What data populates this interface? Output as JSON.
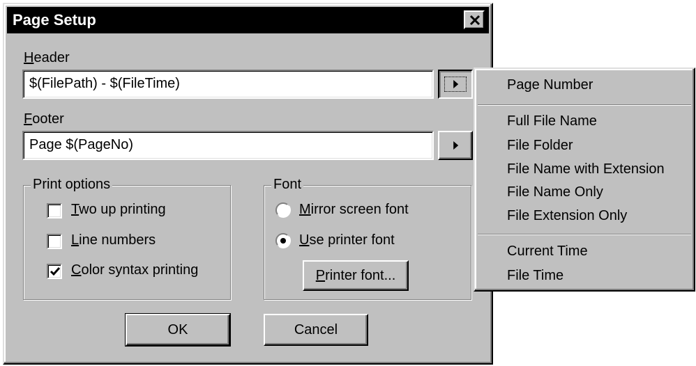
{
  "dialog": {
    "title": "Page Setup",
    "header_label_first": "H",
    "header_label_rest": "eader",
    "header_value": "$(FilePath) - $(FileTime)",
    "footer_label_first": "F",
    "footer_label_rest": "ooter",
    "footer_value": "Page $(PageNo)"
  },
  "print_options": {
    "title": "Print options",
    "items": [
      {
        "first": "T",
        "rest": "wo up printing",
        "checked": false
      },
      {
        "first": "L",
        "rest": "ine numbers",
        "checked": false
      },
      {
        "first": "C",
        "rest": "olor syntax printing",
        "checked": true
      }
    ]
  },
  "font": {
    "title": "Font",
    "options": [
      {
        "first": "M",
        "rest": "irror screen font",
        "selected": false
      },
      {
        "first": "U",
        "rest": "se printer font",
        "selected": true
      }
    ],
    "printer_font_first": "P",
    "printer_font_rest": "rinter font..."
  },
  "buttons": {
    "ok": "OK",
    "cancel": "Cancel"
  },
  "menu": {
    "group1": [
      "Page Number"
    ],
    "group2": [
      "Full File Name",
      "File Folder",
      "File Name with Extension",
      "File Name Only",
      "File Extension Only"
    ],
    "group3": [
      "Current Time",
      "File Time"
    ]
  },
  "icons": {
    "close": "close-icon",
    "arrow": "right-arrow-icon",
    "check": "checkmark-icon",
    "radio": "radio-dot-icon"
  }
}
